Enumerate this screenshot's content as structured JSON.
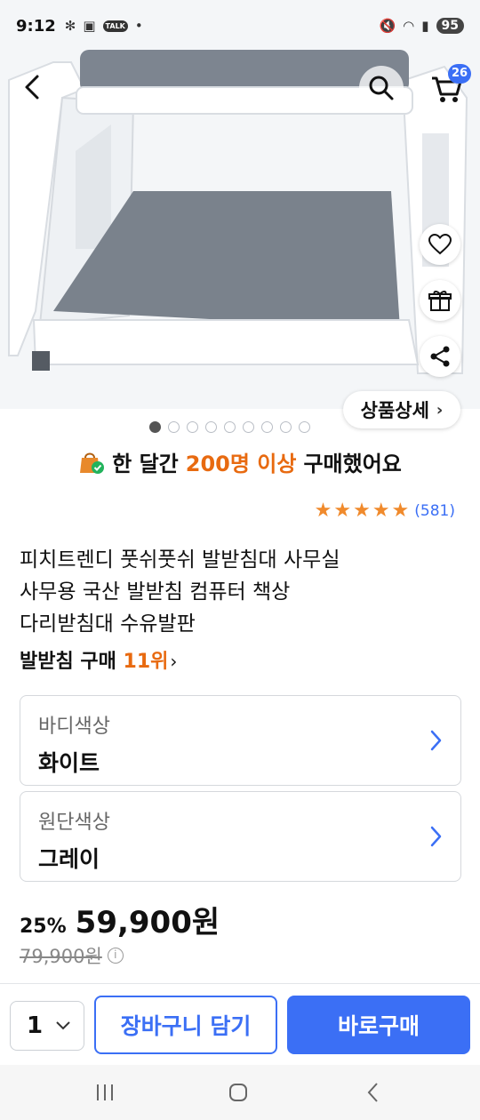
{
  "status_bar": {
    "time": "9:12",
    "battery": "95"
  },
  "header": {
    "cart_count": "26"
  },
  "gallery": {
    "detail_label": "상품상세",
    "total_images": 9,
    "active_index": 0
  },
  "social_proof": {
    "prefix": "한 달간",
    "highlight": "200명 이상",
    "suffix": "구매했어요"
  },
  "rating": {
    "stars": 5,
    "review_count": "(581)"
  },
  "product": {
    "title_line1": "피치트렌디 풋쉬풋쉬 발받침대 사무실",
    "title_line2": "사무용 국산 발받침 컴퓨터 책상",
    "title_line3": "다리받침대 수유발판",
    "rank_label": "발받침 구매",
    "rank_value": "11위"
  },
  "options": [
    {
      "label": "바디색상",
      "value": "화이트"
    },
    {
      "label": "원단색상",
      "value": "그레이"
    }
  ],
  "price": {
    "discount": "25%",
    "sale": "59,900원",
    "original": "79,900원"
  },
  "bottom_bar": {
    "quantity": "1",
    "cart_label": "장바구니 담기",
    "buy_label": "바로구매"
  },
  "colors": {
    "accent": "#3b6ff5",
    "highlight": "#e86a10",
    "star": "#f08a2c"
  }
}
